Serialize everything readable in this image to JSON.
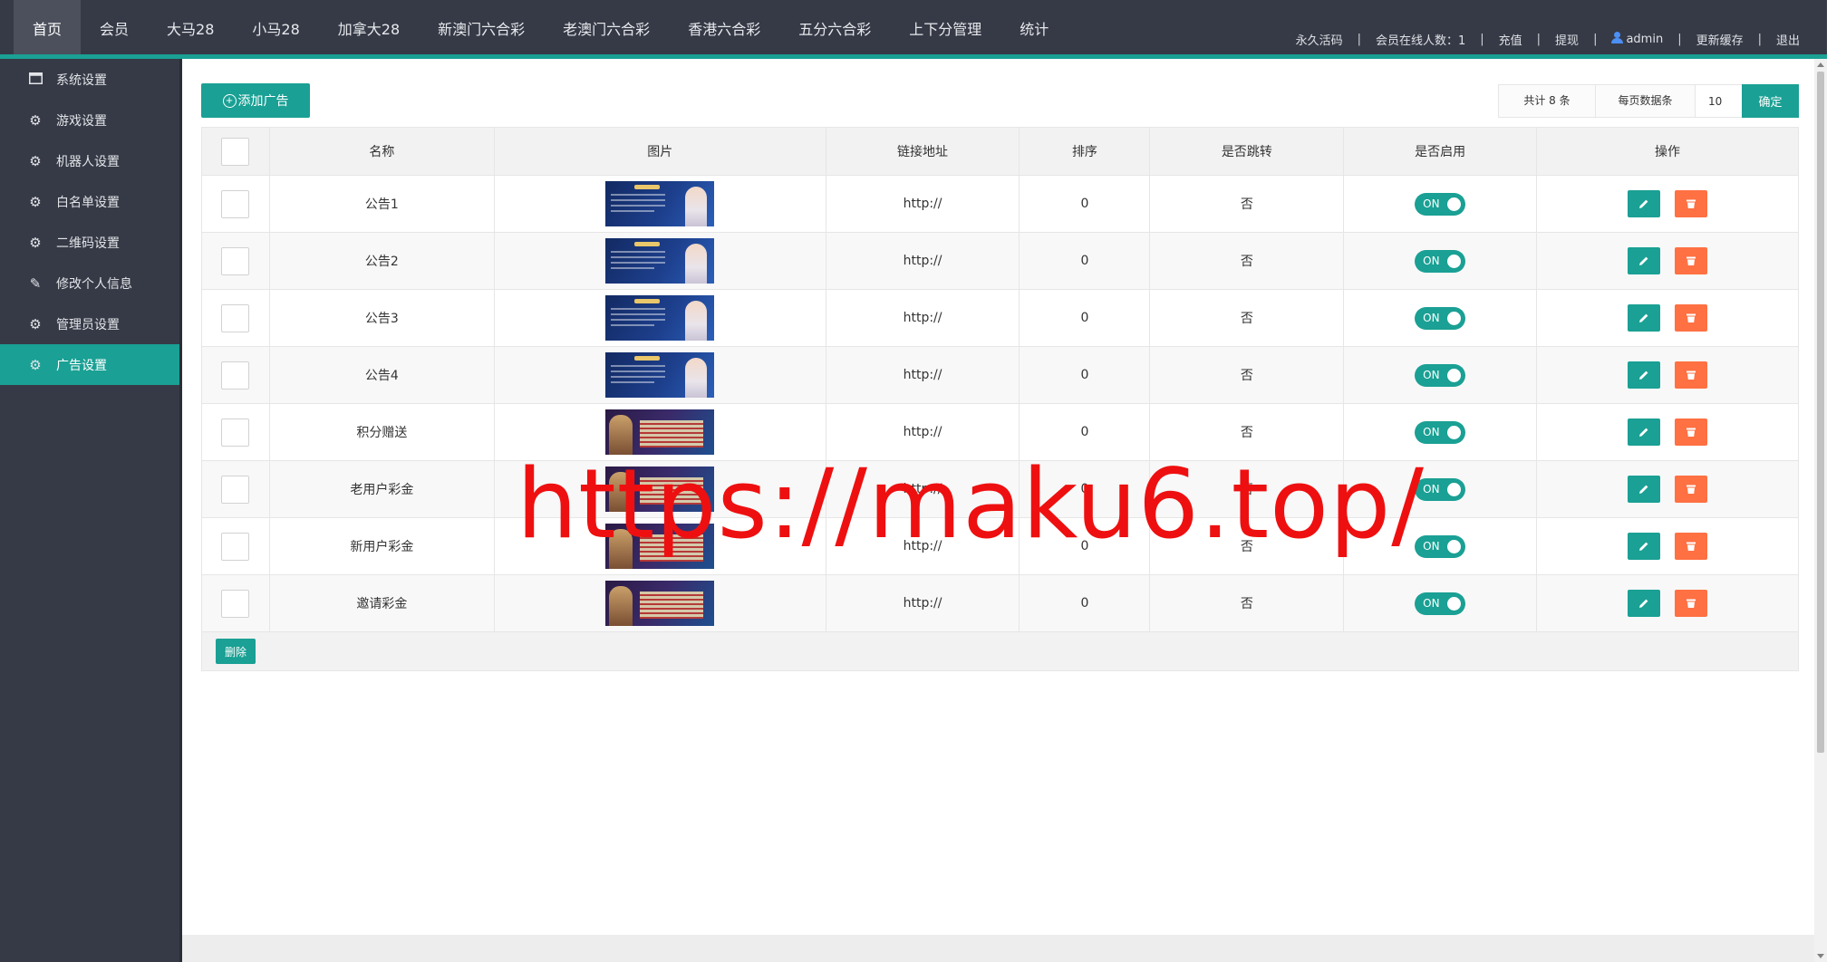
{
  "topnav": {
    "items": [
      "首页",
      "会员",
      "大马28",
      "小马28",
      "加拿大28",
      "新澳门六合彩",
      "老澳门六合彩",
      "香港六合彩",
      "五分六合彩",
      "上下分管理",
      "统计"
    ]
  },
  "topright": {
    "permanent_code": "永久活码",
    "online_members": "会员在线人数：1",
    "recharge": "充值",
    "withdraw": "提现",
    "user": "admin",
    "refresh_cache": "更新缓存",
    "logout": "退出",
    "separator": "|"
  },
  "sidebar": {
    "items": [
      {
        "label": "系统设置",
        "icon": "window-icon"
      },
      {
        "label": "游戏设置",
        "icon": "gear-icon"
      },
      {
        "label": "机器人设置",
        "icon": "gear-icon"
      },
      {
        "label": "白名单设置",
        "icon": "gear-icon"
      },
      {
        "label": "二维码设置",
        "icon": "gear-icon"
      },
      {
        "label": "修改个人信息",
        "icon": "pencil-icon"
      },
      {
        "label": "管理员设置",
        "icon": "gear-icon"
      },
      {
        "label": "广告设置",
        "icon": "gear-icon"
      }
    ]
  },
  "toolbar": {
    "add_label": "添加广告"
  },
  "pager": {
    "total": "共计 8 条",
    "per_page_label": "每页数据条",
    "per_page_value": "10",
    "confirm": "确定"
  },
  "table": {
    "headers": [
      "名称",
      "图片",
      "链接地址",
      "排序",
      "是否跳转",
      "是否启用",
      "操作"
    ],
    "rows": [
      {
        "name": "公告1",
        "link": "http://",
        "sort": "0",
        "jump": "否",
        "enabled": "ON"
      },
      {
        "name": "公告2",
        "link": "http://",
        "sort": "0",
        "jump": "否",
        "enabled": "ON"
      },
      {
        "name": "公告3",
        "link": "http://",
        "sort": "0",
        "jump": "否",
        "enabled": "ON"
      },
      {
        "name": "公告4",
        "link": "http://",
        "sort": "0",
        "jump": "否",
        "enabled": "ON"
      },
      {
        "name": "积分赠送",
        "link": "http://",
        "sort": "0",
        "jump": "否",
        "enabled": "ON"
      },
      {
        "name": "老用户彩金",
        "link": "http://",
        "sort": "0",
        "jump": "否",
        "enabled": "ON"
      },
      {
        "name": "新用户彩金",
        "link": "http://",
        "sort": "0",
        "jump": "否",
        "enabled": "ON"
      },
      {
        "name": "邀请彩金",
        "link": "http://",
        "sort": "0",
        "jump": "否",
        "enabled": "ON"
      }
    ],
    "delete_label": "删除"
  },
  "watermark": "https://maku6.top/",
  "colors": {
    "accent": "#1aa094",
    "danger": "#ff7043",
    "nav_bg": "#363a46"
  }
}
